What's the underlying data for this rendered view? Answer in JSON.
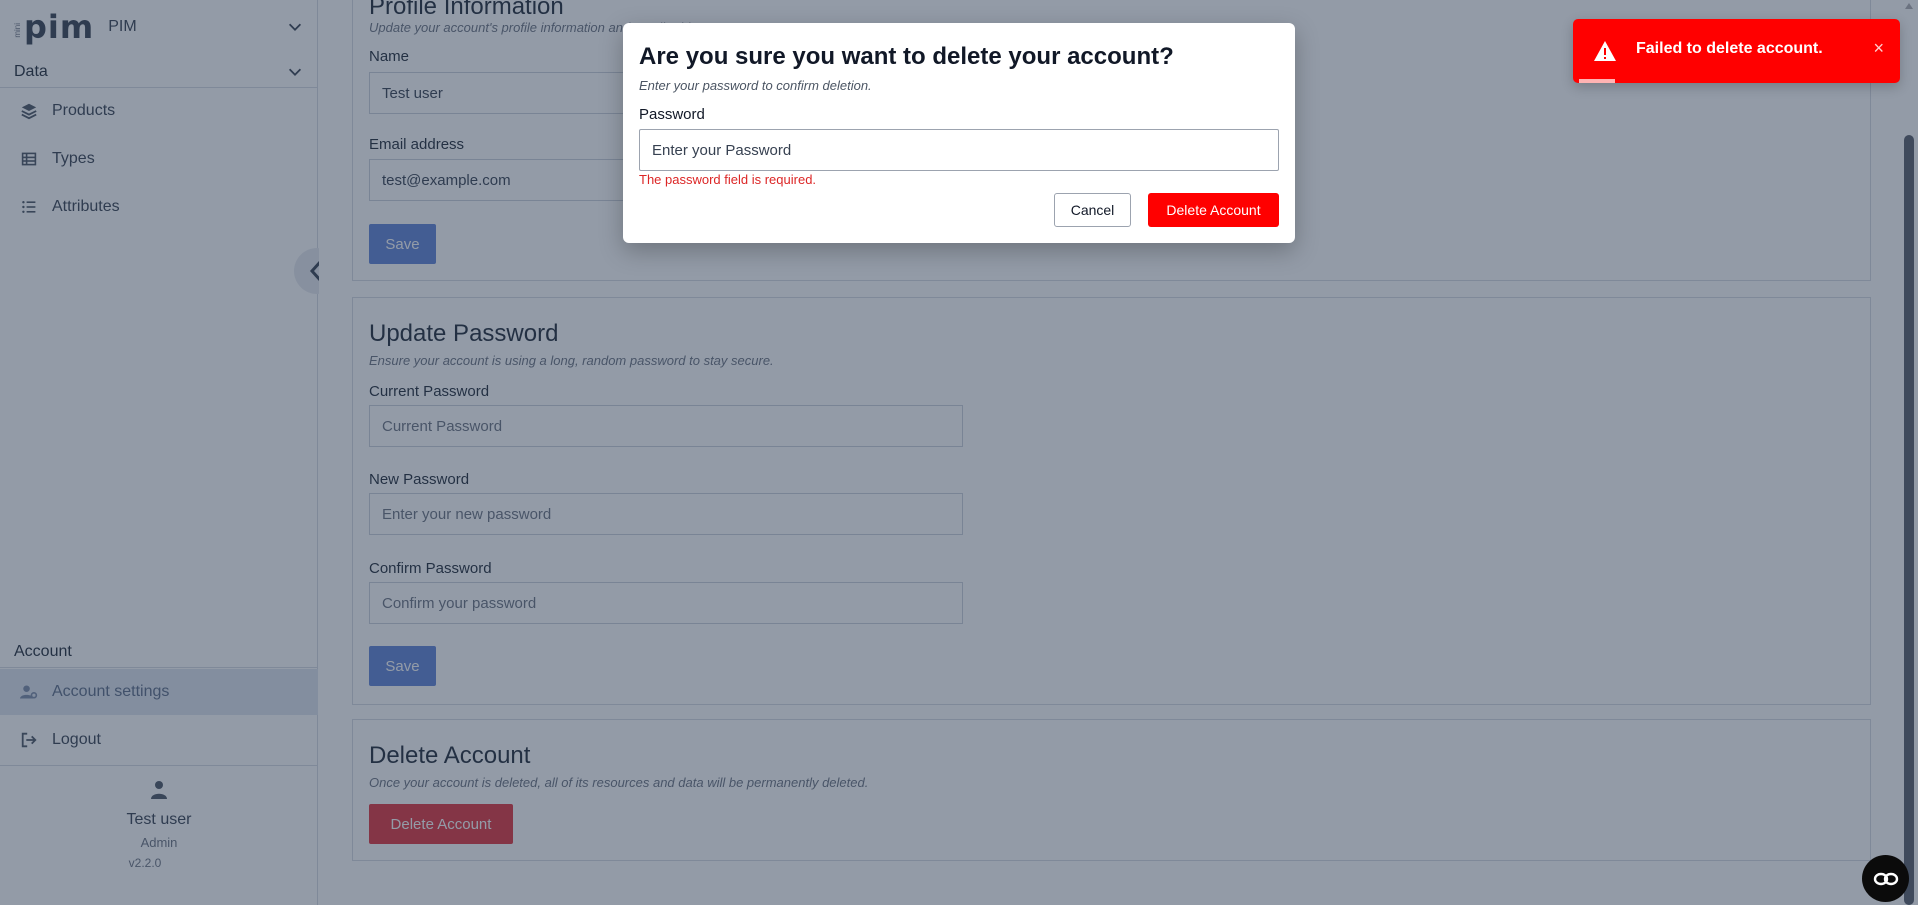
{
  "sidebar": {
    "logo_mini": "mini",
    "logo_text": "pim",
    "app_name": "PIM",
    "data_section": "Data",
    "items": [
      {
        "label": "Products",
        "icon": "layers-icon"
      },
      {
        "label": "Types",
        "icon": "table-icon"
      },
      {
        "label": "Attributes",
        "icon": "list-icon"
      }
    ],
    "account_section": "Account",
    "account_items": [
      {
        "label": "Account settings",
        "icon": "user-gear-icon"
      },
      {
        "label": "Logout",
        "icon": "logout-icon"
      }
    ],
    "user": {
      "name": "Test user",
      "role": "Admin",
      "version": "v2.2.0"
    }
  },
  "profile": {
    "title": "Profile Information",
    "subtitle": "Update your account's profile information and email address.",
    "name_label": "Name",
    "name_value": "Test user",
    "email_label": "Email address",
    "email_value": "test@example.com",
    "save_label": "Save"
  },
  "password": {
    "title": "Update Password",
    "subtitle": "Ensure your account is using a long, random password to stay secure.",
    "current_label": "Current Password",
    "current_placeholder": "Current Password",
    "new_label": "New Password",
    "new_placeholder": "Enter your new password",
    "confirm_label": "Confirm Password",
    "confirm_placeholder": "Confirm your password",
    "save_label": "Save"
  },
  "delete_section": {
    "title": "Delete Account",
    "subtitle": "Once your account is deleted, all of its resources and data will be permanently deleted.",
    "button_label": "Delete Account"
  },
  "modal": {
    "title": "Are you sure you want to delete your account?",
    "subtitle": "Enter your password to confirm deletion.",
    "password_label": "Password",
    "password_placeholder": "Enter your Password",
    "error": "The password field is required.",
    "cancel_label": "Cancel",
    "delete_label": "Delete Account"
  },
  "toast": {
    "message": "Failed to delete account.",
    "close": "×",
    "icon": "warning-icon"
  },
  "colors": {
    "danger": "#ff0000",
    "primary": "#5e82d6",
    "overlay": "rgba(40,55,80,0.5)"
  }
}
